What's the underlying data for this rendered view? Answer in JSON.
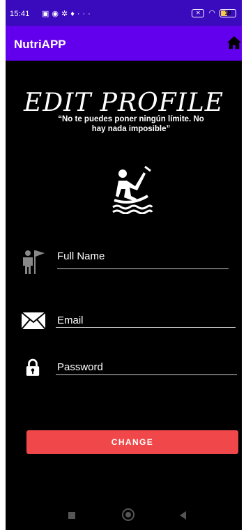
{
  "status_bar": {
    "time": "15:41",
    "icons": [
      "n-icon",
      "chrome-icon",
      "gear-icon",
      "mic-icon",
      "more-icon"
    ],
    "battery": "18"
  },
  "app_bar": {
    "title": "NutriAPP"
  },
  "profile": {
    "heading": "EDIT PROFILE",
    "quote": "“No te puedes poner ningún límite. No hay nada imposible”"
  },
  "form": {
    "full_name_placeholder": "Full Name",
    "email_placeholder": "Email",
    "password_placeholder": "Password"
  },
  "actions": {
    "change_label": "CHANGE"
  },
  "colors": {
    "status_bar": "#3a0bbd",
    "app_bar": "#6200ee",
    "button": "#f0484a",
    "background": "#000000"
  }
}
